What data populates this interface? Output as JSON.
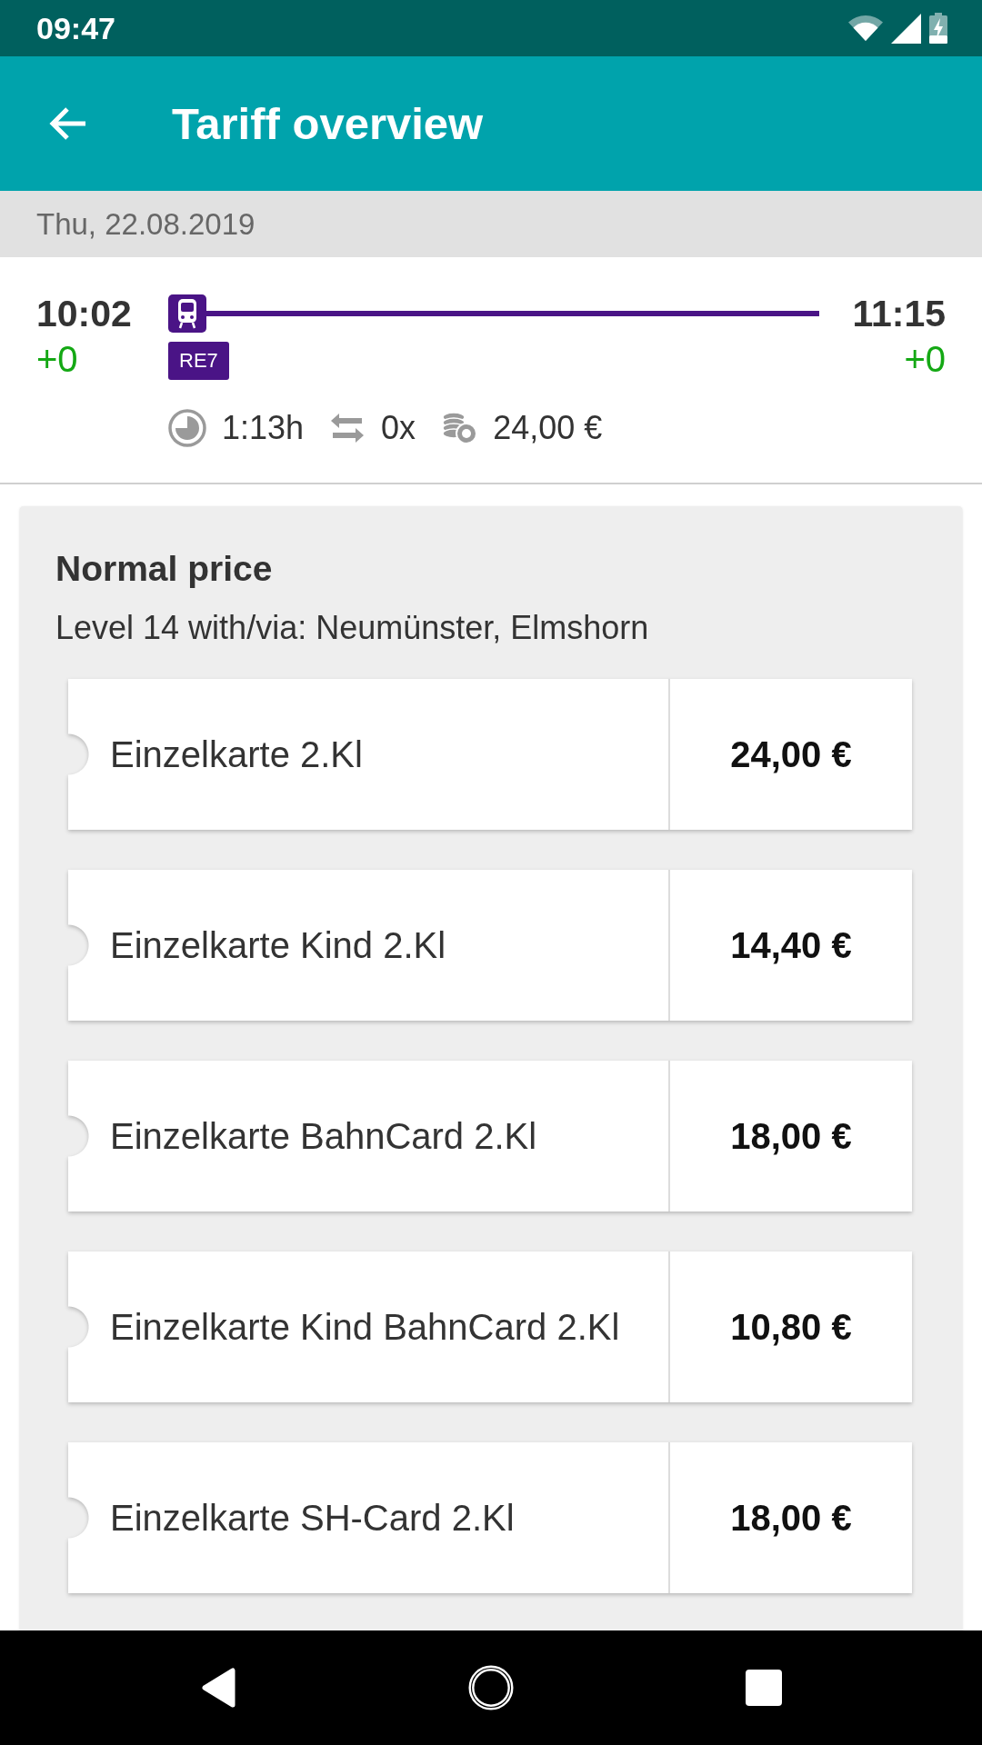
{
  "status_bar": {
    "time": "09:47"
  },
  "app_bar": {
    "title": "Tariff overview"
  },
  "date_bar": {
    "date": "Thu, 22.08.2019"
  },
  "journey": {
    "departure": {
      "time": "10:02",
      "delay": "+0"
    },
    "line": "RE7",
    "arrival": {
      "time": "11:15",
      "delay": "+0"
    },
    "duration": "1:13h",
    "transfers": "0x",
    "price": "24,00 €"
  },
  "tariff": {
    "title": "Normal price",
    "description": "Level 14 with/via: Neumünster, Elmshorn",
    "tickets": [
      {
        "name": "Einzelkarte 2.Kl",
        "price": "24,00 €"
      },
      {
        "name": "Einzelkarte Kind 2.Kl",
        "price": "14,40 €"
      },
      {
        "name": "Einzelkarte BahnCard 2.Kl",
        "price": "18,00 €"
      },
      {
        "name": "Einzelkarte Kind BahnCard 2.Kl",
        "price": "10,80 €"
      },
      {
        "name": "Einzelkarte SH-Card 2.Kl",
        "price": "18,00 €"
      }
    ]
  }
}
